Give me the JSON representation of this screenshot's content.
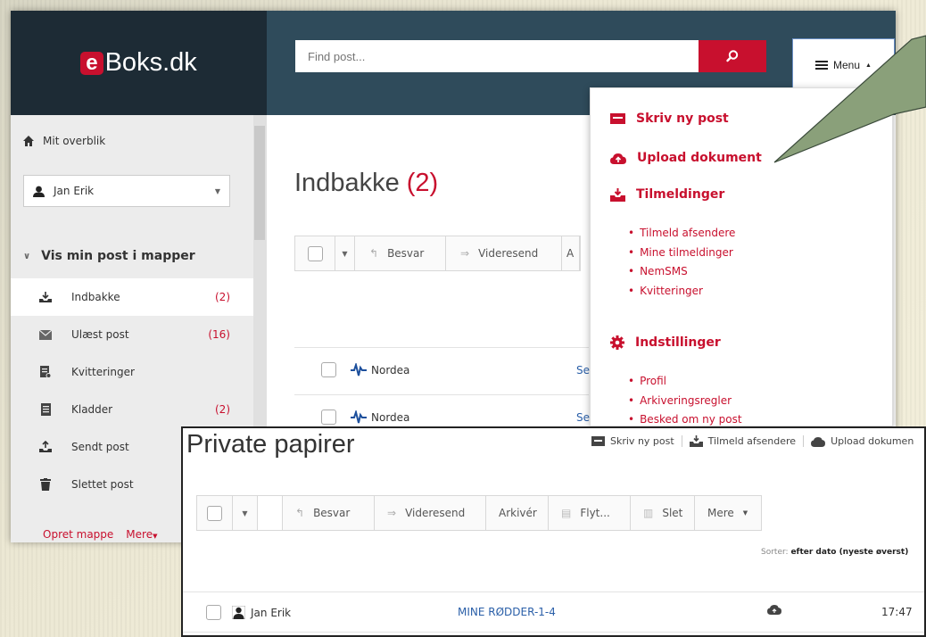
{
  "brand": {
    "e": "e",
    "rest": "Boks.dk"
  },
  "search": {
    "placeholder": "Find post..."
  },
  "menu": {
    "label": "Menu"
  },
  "sidebar": {
    "overview": "Mit overblik",
    "user": "Jan Erik",
    "folders_header": "Vis min post i mapper",
    "folders": [
      {
        "label": "Indbakke",
        "count": "(2)",
        "icon": "inbox-icon"
      },
      {
        "label": "Ulæst post",
        "count": "(16)",
        "icon": "envelope-icon"
      },
      {
        "label": "Kvitteringer",
        "count": "",
        "icon": "receipt-icon"
      },
      {
        "label": "Kladder",
        "count": "(2)",
        "icon": "draft-icon"
      },
      {
        "label": "Sendt post",
        "count": "",
        "icon": "sent-icon"
      },
      {
        "label": "Slettet post",
        "count": "",
        "icon": "trash-icon"
      }
    ],
    "create_folder": "Opret mappe",
    "more": "Mere"
  },
  "inbox": {
    "title": "Indbakke",
    "count": "(2)",
    "toolbar": {
      "reply": "Besvar",
      "forward": "Videresend",
      "archive_partial": "A"
    },
    "rows": [
      {
        "sender": "Nordea",
        "subject": "Se"
      },
      {
        "sender": "Nordea",
        "subject": "Se"
      }
    ]
  },
  "dropdown": {
    "write": "Skriv ny post",
    "upload": "Upload dokument",
    "subscriptions": "Tilmeldinger",
    "subscription_items": [
      "Tilmeld afsendere",
      "Mine tilmeldinger",
      "NemSMS",
      "Kvitteringer"
    ],
    "settings": "Indstillinger",
    "settings_items": [
      "Profil",
      "Arkiveringsregler",
      "Besked om ny post"
    ]
  },
  "private": {
    "title": "Private papirer",
    "actions": {
      "write": "Skriv ny post",
      "subscribe": "Tilmeld afsendere",
      "upload": "Upload dokumen"
    },
    "toolbar": {
      "reply": "Besvar",
      "forward": "Videresend",
      "archive": "Arkivér",
      "move": "Flyt...",
      "delete": "Slet",
      "more": "Mere"
    },
    "sort_label": "Sorter:",
    "sort_value": "efter dato (nyeste øverst)",
    "row": {
      "sender": "Jan Erik",
      "subject": "MINE RØDDER-1-4",
      "time": "17:47"
    }
  },
  "colors": {
    "brand_red": "#c8102e",
    "dark": "#1d2b35",
    "topbar": "#2f4b5b"
  }
}
